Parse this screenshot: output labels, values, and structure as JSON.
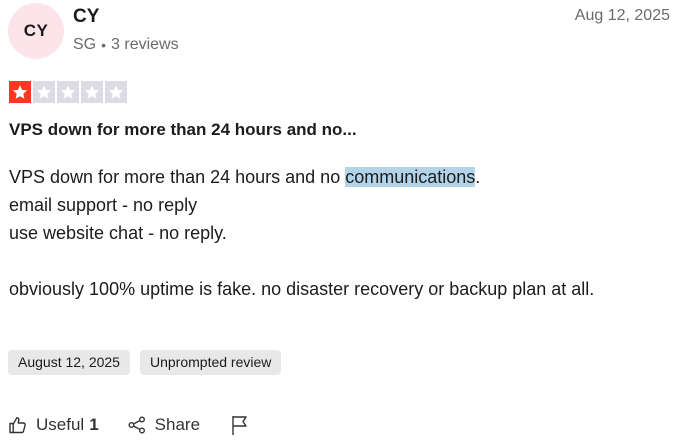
{
  "reviewer": {
    "initials": "CY",
    "name": "CY",
    "country": "SG",
    "separator": "•",
    "review_count": "3 reviews",
    "avatar_color": "#fde3ea"
  },
  "review": {
    "date": "Aug 12, 2025",
    "rating": 1,
    "max_rating": 5,
    "star_active_color": "#ff3722",
    "star_inactive_color": "#dcdce6",
    "title": "VPS down for more than 24 hours and no...",
    "body": {
      "line1_before": "VPS down for more than 24 hours and no ",
      "line1_highlight": "communications",
      "line1_after": ".",
      "line2": "email support - no reply",
      "line3": "use website chat - no reply.",
      "line4": "obviously 100% uptime is fake. no disaster recovery or backup plan at all."
    },
    "tags": [
      "August 12, 2025",
      "Unprompted review"
    ]
  },
  "actions": {
    "useful_label": "Useful",
    "useful_count": "1",
    "share_label": "Share",
    "icons": [
      "thumbs-up-icon",
      "share-icon",
      "flag-icon"
    ]
  }
}
